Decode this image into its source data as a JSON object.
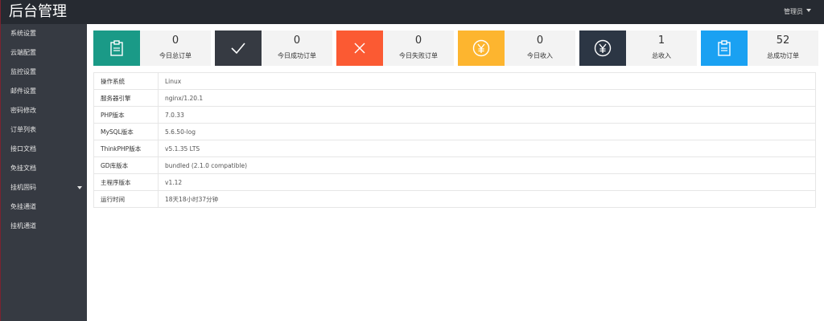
{
  "header": {
    "title": "后台管理",
    "user": "管理员"
  },
  "sidebar": {
    "items": [
      {
        "label": "系统设置"
      },
      {
        "label": "云端配置"
      },
      {
        "label": "监控设置"
      },
      {
        "label": "邮件设置"
      },
      {
        "label": "密码修改"
      },
      {
        "label": "订单列表"
      },
      {
        "label": "接口文档"
      },
      {
        "label": "免挂文档"
      },
      {
        "label": "挂机固码"
      },
      {
        "label": "免挂通道"
      },
      {
        "label": "挂机通道"
      }
    ]
  },
  "cards": [
    {
      "value": "0",
      "label": "今日总订单",
      "icon": "clipboard-icon",
      "color": "#1a9a87"
    },
    {
      "value": "0",
      "label": "今日成功订单",
      "icon": "check-icon",
      "color": "#363a42"
    },
    {
      "value": "0",
      "label": "今日失败订单",
      "icon": "close-icon",
      "color": "#fb5a33"
    },
    {
      "value": "0",
      "label": "今日收入",
      "icon": "yen-icon",
      "color": "#fdb52f"
    },
    {
      "value": "1",
      "label": "总收入",
      "icon": "yen-circle-icon",
      "color": "#2c3644"
    },
    {
      "value": "52",
      "label": "总成功订单",
      "icon": "clipboard-icon",
      "color": "#1aa1f2"
    }
  ],
  "info": [
    {
      "key": "操作系统",
      "value": "Linux"
    },
    {
      "key": "服务器引擎",
      "value": "nginx/1.20.1"
    },
    {
      "key": "PHP版本",
      "value": "7.0.33"
    },
    {
      "key": "MySQL版本",
      "value": "5.6.50-log"
    },
    {
      "key": "ThinkPHP版本",
      "value": "v5.1.35 LTS"
    },
    {
      "key": "GD库版本",
      "value": "bundled (2.1.0 compatible)"
    },
    {
      "key": "主程序版本",
      "value": "v1.12"
    },
    {
      "key": "运行时间",
      "value": "18天18小时37分钟"
    }
  ]
}
